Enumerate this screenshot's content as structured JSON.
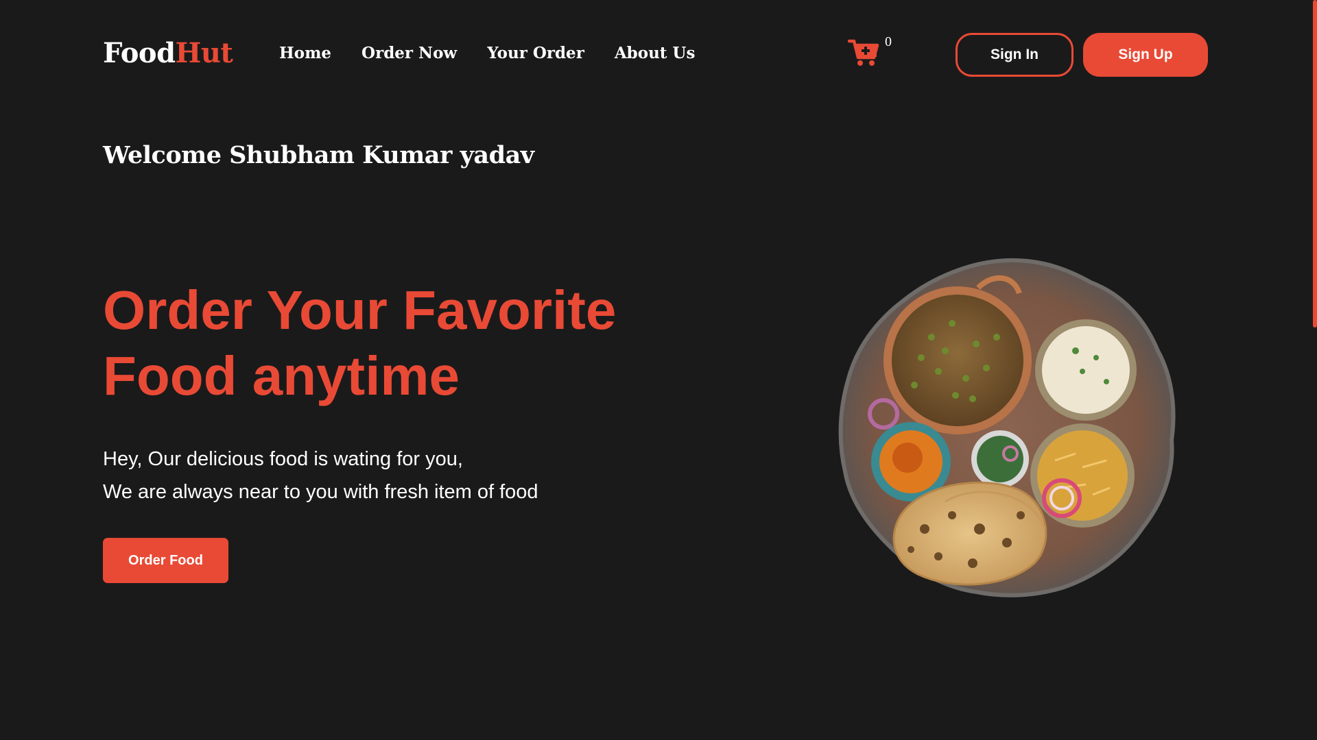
{
  "brand": {
    "name_part1": "Food",
    "name_part2": "Hut",
    "primary_color": "#e94a35",
    "background_color": "#1b1a1b"
  },
  "nav": {
    "links": [
      {
        "label": "Home"
      },
      {
        "label": "Order Now"
      },
      {
        "label": "Your Order"
      },
      {
        "label": "About Us"
      }
    ],
    "cart": {
      "icon": "cart-icon",
      "count": "0"
    },
    "sign_in_label": "Sign In",
    "sign_up_label": "Sign Up"
  },
  "welcome": {
    "text": "Welcome Shubham Kumar yadav"
  },
  "hero": {
    "title_line1": "Order Your Favorite",
    "title_line2": "Food anytime",
    "subtitle_line1": "Hey, Our delicious food is wating for you,",
    "subtitle_line2": "We are always near to you with fresh item of food",
    "cta_label": "Order Food",
    "image_icon": "food-platter-image"
  }
}
